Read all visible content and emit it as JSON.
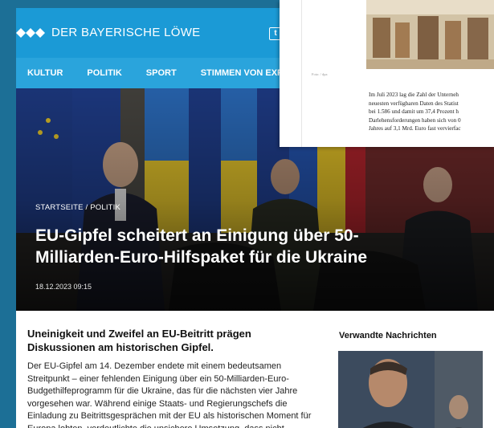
{
  "header": {
    "site_title": "DER BAYERISCHE LÖWE"
  },
  "nav": {
    "items": [
      "KULTUR",
      "POLITIK",
      "SPORT",
      "STIMMEN VON EXPE"
    ]
  },
  "article": {
    "breadcrumb": "STARTSEITE / POLITIK",
    "headline": "EU-Gipfel scheitert an Einigung über 50-Milliarden-Euro-Hilfspaket für die Ukraine",
    "date": "18.12.2023 09:15",
    "lead": "Uneinigkeit und Zweifel an EU-Beitritt prägen Diskussionen am historischen Gipfel.",
    "body": "Der EU-Gipfel am 14. Dezember endete mit einem bedeutsamen Streitpunkt – einer fehlenden Einigung über ein 50-Milliarden-Euro-Budgethilfeprogramm für die Ukraine, das für die nächsten vier Jahre vorgesehen war. Während einige Staats- und Regierungschefs die Einladung zu Beitrittsgesprächen mit der EU als historischen Moment für Europa lobten, verdeutlichte die unsichere Umsetzung, dass nicht"
  },
  "sidebar": {
    "title": "Verwandte Nachrichten"
  },
  "overlay": {
    "credit": "Foto: / dpa",
    "lines": [
      "Im Juli 2023 lag die Zahl der Unterneh",
      "neuesten verfügbaren Daten des Statist",
      "bei 1.586 und damit um 37,4 Prozent h",
      "Darlehensforderungen haben sich von 0",
      "Jahres auf 3,1 Mrd. Euro fast vervierfac"
    ]
  },
  "colors": {
    "topbar": "#1b9ad6",
    "nav": "#2aa4dc",
    "background": "#1c6f96"
  }
}
